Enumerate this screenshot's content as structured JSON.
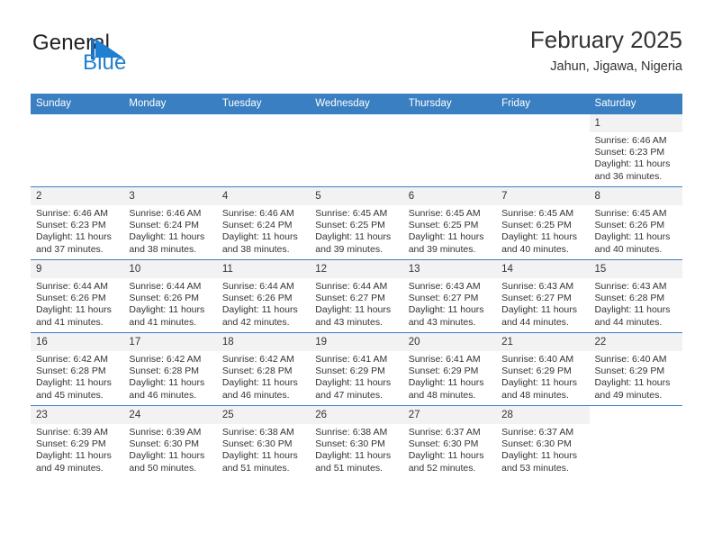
{
  "brand": {
    "name_part1": "General",
    "name_part2": "Blue",
    "logo_icon": "blue-triangle-flag-icon",
    "accent_color": "#1f7fd0"
  },
  "header": {
    "title": "February 2025",
    "subtitle": "Jahun, Jigawa, Nigeria"
  },
  "colors": {
    "header_row_bg": "#3a7fc1",
    "daynum_bg": "#f2f2f2",
    "text": "#333333",
    "separator": "#3a7fc1"
  },
  "weekday_headers": [
    "Sunday",
    "Monday",
    "Tuesday",
    "Wednesday",
    "Thursday",
    "Friday",
    "Saturday"
  ],
  "weeks": [
    [
      {
        "day": "",
        "empty": true
      },
      {
        "day": "",
        "empty": true
      },
      {
        "day": "",
        "empty": true
      },
      {
        "day": "",
        "empty": true
      },
      {
        "day": "",
        "empty": true
      },
      {
        "day": "",
        "empty": true
      },
      {
        "day": "1",
        "sunrise": "Sunrise: 6:46 AM",
        "sunset": "Sunset: 6:23 PM",
        "daylight": "Daylight: 11 hours and 36 minutes."
      }
    ],
    [
      {
        "day": "2",
        "sunrise": "Sunrise: 6:46 AM",
        "sunset": "Sunset: 6:23 PM",
        "daylight": "Daylight: 11 hours and 37 minutes."
      },
      {
        "day": "3",
        "sunrise": "Sunrise: 6:46 AM",
        "sunset": "Sunset: 6:24 PM",
        "daylight": "Daylight: 11 hours and 38 minutes."
      },
      {
        "day": "4",
        "sunrise": "Sunrise: 6:46 AM",
        "sunset": "Sunset: 6:24 PM",
        "daylight": "Daylight: 11 hours and 38 minutes."
      },
      {
        "day": "5",
        "sunrise": "Sunrise: 6:45 AM",
        "sunset": "Sunset: 6:25 PM",
        "daylight": "Daylight: 11 hours and 39 minutes."
      },
      {
        "day": "6",
        "sunrise": "Sunrise: 6:45 AM",
        "sunset": "Sunset: 6:25 PM",
        "daylight": "Daylight: 11 hours and 39 minutes."
      },
      {
        "day": "7",
        "sunrise": "Sunrise: 6:45 AM",
        "sunset": "Sunset: 6:25 PM",
        "daylight": "Daylight: 11 hours and 40 minutes."
      },
      {
        "day": "8",
        "sunrise": "Sunrise: 6:45 AM",
        "sunset": "Sunset: 6:26 PM",
        "daylight": "Daylight: 11 hours and 40 minutes."
      }
    ],
    [
      {
        "day": "9",
        "sunrise": "Sunrise: 6:44 AM",
        "sunset": "Sunset: 6:26 PM",
        "daylight": "Daylight: 11 hours and 41 minutes."
      },
      {
        "day": "10",
        "sunrise": "Sunrise: 6:44 AM",
        "sunset": "Sunset: 6:26 PM",
        "daylight": "Daylight: 11 hours and 41 minutes."
      },
      {
        "day": "11",
        "sunrise": "Sunrise: 6:44 AM",
        "sunset": "Sunset: 6:26 PM",
        "daylight": "Daylight: 11 hours and 42 minutes."
      },
      {
        "day": "12",
        "sunrise": "Sunrise: 6:44 AM",
        "sunset": "Sunset: 6:27 PM",
        "daylight": "Daylight: 11 hours and 43 minutes."
      },
      {
        "day": "13",
        "sunrise": "Sunrise: 6:43 AM",
        "sunset": "Sunset: 6:27 PM",
        "daylight": "Daylight: 11 hours and 43 minutes."
      },
      {
        "day": "14",
        "sunrise": "Sunrise: 6:43 AM",
        "sunset": "Sunset: 6:27 PM",
        "daylight": "Daylight: 11 hours and 44 minutes."
      },
      {
        "day": "15",
        "sunrise": "Sunrise: 6:43 AM",
        "sunset": "Sunset: 6:28 PM",
        "daylight": "Daylight: 11 hours and 44 minutes."
      }
    ],
    [
      {
        "day": "16",
        "sunrise": "Sunrise: 6:42 AM",
        "sunset": "Sunset: 6:28 PM",
        "daylight": "Daylight: 11 hours and 45 minutes."
      },
      {
        "day": "17",
        "sunrise": "Sunrise: 6:42 AM",
        "sunset": "Sunset: 6:28 PM",
        "daylight": "Daylight: 11 hours and 46 minutes."
      },
      {
        "day": "18",
        "sunrise": "Sunrise: 6:42 AM",
        "sunset": "Sunset: 6:28 PM",
        "daylight": "Daylight: 11 hours and 46 minutes."
      },
      {
        "day": "19",
        "sunrise": "Sunrise: 6:41 AM",
        "sunset": "Sunset: 6:29 PM",
        "daylight": "Daylight: 11 hours and 47 minutes."
      },
      {
        "day": "20",
        "sunrise": "Sunrise: 6:41 AM",
        "sunset": "Sunset: 6:29 PM",
        "daylight": "Daylight: 11 hours and 48 minutes."
      },
      {
        "day": "21",
        "sunrise": "Sunrise: 6:40 AM",
        "sunset": "Sunset: 6:29 PM",
        "daylight": "Daylight: 11 hours and 48 minutes."
      },
      {
        "day": "22",
        "sunrise": "Sunrise: 6:40 AM",
        "sunset": "Sunset: 6:29 PM",
        "daylight": "Daylight: 11 hours and 49 minutes."
      }
    ],
    [
      {
        "day": "23",
        "sunrise": "Sunrise: 6:39 AM",
        "sunset": "Sunset: 6:29 PM",
        "daylight": "Daylight: 11 hours and 49 minutes."
      },
      {
        "day": "24",
        "sunrise": "Sunrise: 6:39 AM",
        "sunset": "Sunset: 6:30 PM",
        "daylight": "Daylight: 11 hours and 50 minutes."
      },
      {
        "day": "25",
        "sunrise": "Sunrise: 6:38 AM",
        "sunset": "Sunset: 6:30 PM",
        "daylight": "Daylight: 11 hours and 51 minutes."
      },
      {
        "day": "26",
        "sunrise": "Sunrise: 6:38 AM",
        "sunset": "Sunset: 6:30 PM",
        "daylight": "Daylight: 11 hours and 51 minutes."
      },
      {
        "day": "27",
        "sunrise": "Sunrise: 6:37 AM",
        "sunset": "Sunset: 6:30 PM",
        "daylight": "Daylight: 11 hours and 52 minutes."
      },
      {
        "day": "28",
        "sunrise": "Sunrise: 6:37 AM",
        "sunset": "Sunset: 6:30 PM",
        "daylight": "Daylight: 11 hours and 53 minutes."
      },
      {
        "day": "",
        "empty": true
      }
    ]
  ]
}
